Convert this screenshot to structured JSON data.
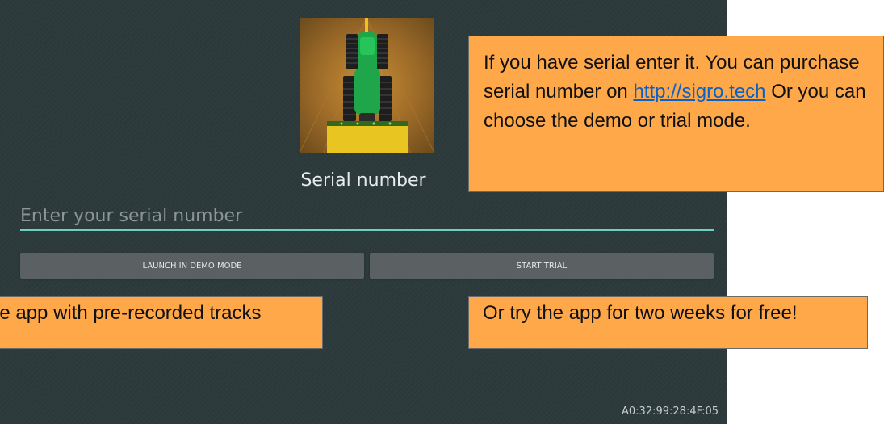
{
  "screen": {
    "title": "Serial number",
    "serial_input": {
      "value": "",
      "placeholder": "Enter your serial number"
    },
    "buttons": {
      "demo": "LAUNCH IN DEMO MODE",
      "trial": "START TRIAL"
    },
    "device_id": "A0:32:99:28:4F:05",
    "colors": {
      "background": "#2c3a3c",
      "accent": "#6fcfc3",
      "button": "#5b6162"
    }
  },
  "logo": {
    "icon": "tractor-icon"
  },
  "tooltips": {
    "top": {
      "text_before": "If you have serial enter it. You can purchase serial number on ",
      "link": "http://sigro.tech",
      "text_after": " Or you can choose the demo or trial mode."
    },
    "left": "he app with pre-recorded tracks",
    "right": "Or try the app for two weeks for free!",
    "color": "#ffa84a"
  }
}
